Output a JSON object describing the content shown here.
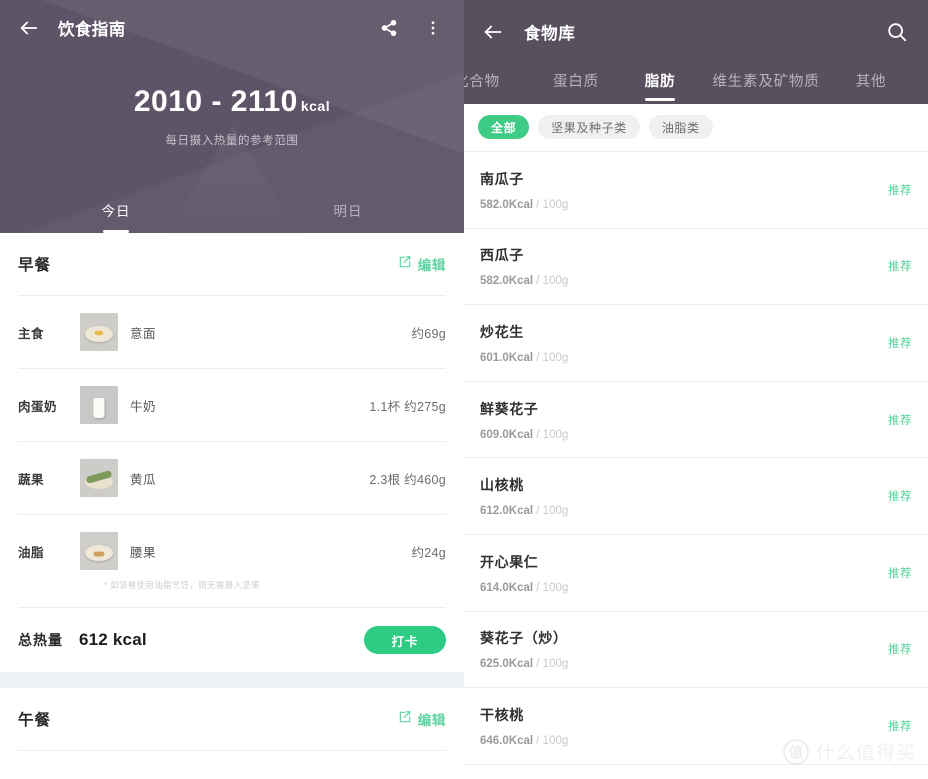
{
  "left": {
    "appbar": {
      "title": "饮食指南",
      "back_icon": "arrow-left-icon",
      "share_icon": "share-icon",
      "more_icon": "more-vertical-icon"
    },
    "hero": {
      "calorie_range": "2010 - 2110",
      "calorie_unit": "kcal",
      "subtitle": "每日摄入热量的参考范围",
      "tabs": [
        {
          "label": "今日",
          "active": true
        },
        {
          "label": "明日",
          "active": false
        }
      ]
    },
    "breakfast": {
      "title": "早餐",
      "edit_label": "编辑",
      "rows": [
        {
          "category": "主食",
          "name": "意面",
          "amount": "约69g",
          "thumb": "pasta-plate-thumbnail"
        },
        {
          "category": "肉蛋奶",
          "name": "牛奶",
          "amount": "1.1杯 约275g",
          "thumb": "milk-glass-thumbnail"
        },
        {
          "category": "蔬果",
          "name": "黄瓜",
          "amount": "2.3根 约460g",
          "thumb": "cucumber-plate-thumbnail"
        },
        {
          "category": "油脂",
          "name": "腰果",
          "amount": "约24g",
          "thumb": "cashew-plate-thumbnail"
        }
      ],
      "footnote": "* 如该餐使用油脂烹饪，则无需摄入坚果",
      "total_label": "总热量",
      "total_value": "612 kcal",
      "checkin_label": "打卡"
    },
    "lunch": {
      "title": "午餐",
      "edit_label": "编辑"
    }
  },
  "right": {
    "appbar": {
      "title": "食物库",
      "back_icon": "arrow-left-icon",
      "search_icon": "search-icon"
    },
    "tabs": [
      {
        "label": "化合物",
        "active": false
      },
      {
        "label": "蛋白质",
        "active": false
      },
      {
        "label": "脂肪",
        "active": true
      },
      {
        "label": "维生素及矿物质",
        "active": false
      },
      {
        "label": "其他",
        "active": false
      }
    ],
    "chips": [
      {
        "label": "全部",
        "active": true
      },
      {
        "label": "坚果及种子类",
        "active": false
      },
      {
        "label": "油脂类",
        "active": false
      }
    ],
    "foods": [
      {
        "name": "南瓜子",
        "kcal": "582.0Kcal",
        "per": "/ 100g",
        "tag": "推荐"
      },
      {
        "name": "西瓜子",
        "kcal": "582.0Kcal",
        "per": "/ 100g",
        "tag": "推荐"
      },
      {
        "name": "炒花生",
        "kcal": "601.0Kcal",
        "per": "/ 100g",
        "tag": "推荐"
      },
      {
        "name": "鲜葵花子",
        "kcal": "609.0Kcal",
        "per": "/ 100g",
        "tag": "推荐"
      },
      {
        "name": "山核桃",
        "kcal": "612.0Kcal",
        "per": "/ 100g",
        "tag": "推荐"
      },
      {
        "name": "开心果仁",
        "kcal": "614.0Kcal",
        "per": "/ 100g",
        "tag": "推荐"
      },
      {
        "name": "葵花子（炒）",
        "kcal": "625.0Kcal",
        "per": "/ 100g",
        "tag": "推荐"
      },
      {
        "name": "干核桃",
        "kcal": "646.0Kcal",
        "per": "/ 100g",
        "tag": "推荐"
      }
    ],
    "watermark": {
      "mark": "值",
      "text": "什么值得买"
    }
  },
  "colors": {
    "header_purple": "#5d5467",
    "header_purple_right": "#58505f",
    "accent_green": "#2ecc82",
    "chip_green": "#3ecb85",
    "link_green": "#5fd4a3",
    "tag_green": "#4fd29a"
  }
}
